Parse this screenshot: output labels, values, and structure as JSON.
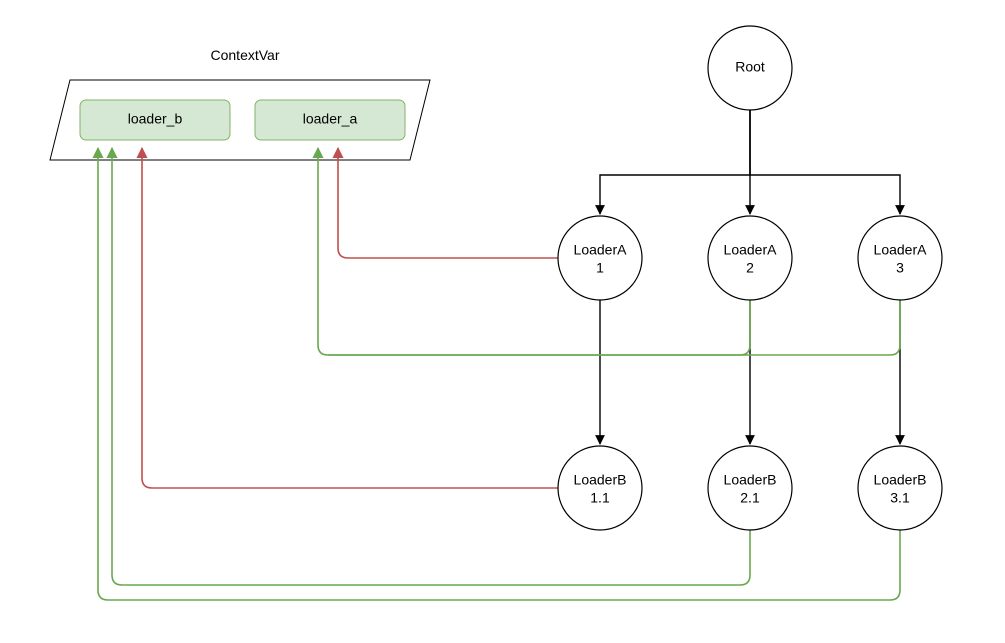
{
  "contextVar": {
    "title": "ContextVar",
    "entries": [
      {
        "id": "loader_b",
        "label": "loader_b"
      },
      {
        "id": "loader_a",
        "label": "loader_a"
      }
    ]
  },
  "nodes": {
    "root": {
      "label_top": "Root",
      "label_bottom": ""
    },
    "a1": {
      "label_top": "LoaderA",
      "label_bottom": "1"
    },
    "a2": {
      "label_top": "LoaderA",
      "label_bottom": "2"
    },
    "a3": {
      "label_top": "LoaderA",
      "label_bottom": "3"
    },
    "b11": {
      "label_top": "LoaderB",
      "label_bottom": "1.1"
    },
    "b21": {
      "label_top": "LoaderB",
      "label_bottom": "2.1"
    },
    "b31": {
      "label_top": "LoaderB",
      "label_bottom": "3.1"
    }
  },
  "colors": {
    "green": "#6aa84f",
    "red": "#c0504d",
    "ctxFill": "#d5e8d4",
    "ctxStroke": "#82b366"
  },
  "edges": {
    "tree": [
      {
        "from": "root",
        "to": "a1"
      },
      {
        "from": "root",
        "to": "a2"
      },
      {
        "from": "root",
        "to": "a3"
      },
      {
        "from": "a1",
        "to": "b11"
      },
      {
        "from": "a2",
        "to": "b21"
      },
      {
        "from": "a3",
        "to": "b31"
      }
    ],
    "green_to_loader_a_from": [
      "a2",
      "a3"
    ],
    "green_to_loader_b_from": [
      "b21",
      "b31"
    ],
    "red_to_loader_a_from": [
      "a1"
    ],
    "red_to_loader_b_from": [
      "b11"
    ]
  }
}
